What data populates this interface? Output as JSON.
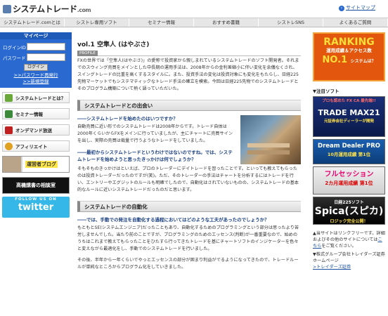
{
  "header": {
    "logo_text": "システムトレード",
    "logo_suffix": ".com",
    "sitemap_label": "サイトマップ"
  },
  "nav": [
    "システムトレード.comとは",
    "シストレ専用ソフト",
    "セミナー情報",
    "おすすめ書籍",
    "シストレSNS",
    "よくあるご質問"
  ],
  "login": {
    "title": "マイページ",
    "id_label": "ログインID",
    "password_label": "パスワード",
    "button": "ログイン",
    "forgot": ">>パスワード再発行",
    "register": ">>新規登録"
  },
  "side_menu": [
    {
      "label": "システムトレードとは？",
      "icon": "leaf-icon",
      "color": "#6aa83a"
    },
    {
      "label": "セミナー情報",
      "icon": "pencil-icon",
      "color": "#3a8a3a"
    },
    {
      "label": "オンデマンド放送",
      "icon": "camera-icon",
      "color": "#c02020"
    },
    {
      "label": "アフィリエイト",
      "icon": "coin-icon",
      "color": "#e0a020"
    }
  ],
  "side_banners": {
    "blog": "運営者ブログ",
    "soudan": "高機講書の相談室",
    "twitter_top": "FOLLOW US ON",
    "twitter": "twitter"
  },
  "main": {
    "vol_title": "vol.1 空隼人 (はやぶさ)",
    "profile_tag": "PROFILE",
    "intro": "FXの世界では「空隼人(はやぶさ)」の愛称で投資家から親しまれているシステムトレードのソフト開発者。それまでのスウィング売買をメインとした中長期の運用手法は、2008年からの金利差縮小に伴い変化を余儀なくされ、スイングトレードの比重を高くするスタイルに。また、投資手法の変化は投資対象にも変化をもたらし、日経225先物マーケットでもシステマティックなトレード手法の確立を模索。今回は日経225先物でのシステムトレードとそのプログラム構築について熱く語っていただいた。",
    "section1": "システムトレードとの出会い",
    "q1": "――システムトレードを始めたのはいつですか？",
    "a1": "自動売買に近い形でのシステムトレードは2008年からです。トレード自体は2000年くらいからFXをメインに行っていましたが、主にチャートに売買サインを出し、実際の売買は裁量で行うようなトレードをしていました。",
    "q2": "――最初からシステムトレードというわけではないのですね。では、システムトレードを始めようと思ったきっかけは何でしょうか？",
    "a2": "そもそものきっかけはといえば、プロのトレーダーにデイトレードを習ったことです。といっても教えてもらったのは投資トレーダーだったのですが(笑)。ただ、そのトレーダーの手法はチャートを分析するにはトレードを行い、エントリーやエグジットのルールも明確でしたので、自動化はされていないものの、システムトレードの基本的なルールに近いシステムトレードだったのだと思います。",
    "section2": "システムトレードの自動化",
    "q3": "――では、手動での発注を自動化する過程においてはどのような工夫があったのでしょうか？",
    "a3": "もともとSE(システムエンジニア)だったこともあり、自動化するためのプログラミングという部分は思ったより苦労しませんでした。当たり前のことですが、プログラミングのためのエッセンス(判断)が一番重要なので、始めのうちはこれまで教えてもらったことをひたすら行ってきたトレードを基にチャートソフトのインジケーターを色々と変えながら最適化をし、手動でのシステムトレードを行いました。",
    "a4": "その後、半年から一年くらいでやっとエッセンスの部分が固まり利益がでるようになってきたので、トレードルールが単純なところからプログラム化をしていきました。"
  },
  "right": {
    "rank_big": "RANKING",
    "rank_mid": "運用成績＆アクセス数",
    "rank_no1": "NO.1",
    "rank_small": "システムは？",
    "note_title": "▼注目ソフト",
    "ad1_top": "プロも認めた FX CA 最先端!!",
    "ad1_title": "TRADE MAX21",
    "ad1_sub": "元証券会社ディーラーが開発",
    "ad2_title": "Dream Dealer PRO",
    "ad2_sub": "10月運用成績 第1位",
    "ad3_title": "フルセッション",
    "ad3_sub": "2カ月運用成績 第1位",
    "ad4_top": "日経225ソフト",
    "ad4_title": "Spica(スピカ)",
    "ad4_sub": "ロジック完全公開！",
    "footer_text": "▲当サイトはリンクフリーです。詳細およびその他のサイトについては",
    "footer_link1": "こちら",
    "footer_text2": "をご覧ください。",
    "footer_text3": "▼株式グループ会社トレイダーズ証券ホームページ",
    "footer_link2": ">トレイダーズ証券"
  }
}
